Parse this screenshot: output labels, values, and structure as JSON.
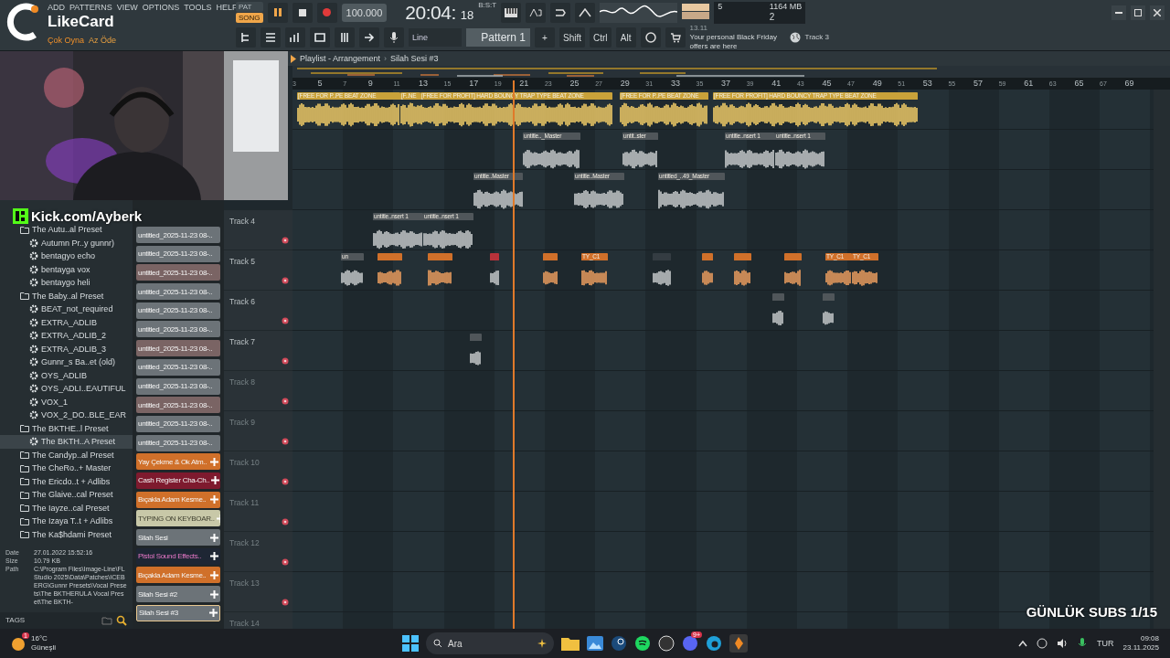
{
  "toolbar": {
    "menu": [
      "ADD",
      "PATTERNS",
      "VIEW",
      "OPTIONS",
      "TOOLS",
      "HELP"
    ],
    "brand": {
      "name": "LikeCard",
      "slogan_1": "Çok Oyna",
      "slogan_2": "Az Öde"
    },
    "mode": [
      {
        "label": "PAT",
        "selected": false
      },
      {
        "label": "SONG",
        "selected": true
      }
    ],
    "tempo": "100.000",
    "time": "20:04:",
    "time_small": "18",
    "time_unit": "B:S:T",
    "cpu": "5",
    "memory": "1164 MB",
    "polyphony": "2",
    "hint": "Track 3",
    "input": "Line",
    "pattern": "Pattern 1",
    "add": "+",
    "modifiers": [
      "Shift",
      "Ctrl",
      "Alt"
    ],
    "news": {
      "date": "13.11",
      "text": "Your personal Black Friday offers are here"
    }
  },
  "overlays": {
    "kick": "Kick.com/Ayberk",
    "subs": "GÜNLÜK SUBS 1/15"
  },
  "browser": {
    "items": [
      {
        "name": "The Autu..al Preset",
        "kind": "folder",
        "selected": false,
        "children": [
          {
            "name": "Autumn Pr..y gunnr)",
            "kind": "preset",
            "selected": false
          },
          {
            "name": "bentagyo echo",
            "kind": "preset",
            "selected": false
          },
          {
            "name": "bentayga vox",
            "kind": "preset",
            "selected": false
          },
          {
            "name": "bentaygo heli",
            "kind": "preset",
            "selected": false
          }
        ]
      },
      {
        "name": "The Baby..al Preset",
        "kind": "folder",
        "selected": false,
        "children": [
          {
            "name": "BEAT_not_required",
            "kind": "preset",
            "selected": false
          },
          {
            "name": "EXTRA_ADLIB",
            "kind": "preset",
            "selected": false
          },
          {
            "name": "EXTRA_ADLIB_2",
            "kind": "preset",
            "selected": false
          },
          {
            "name": "EXTRA_ADLIB_3",
            "kind": "preset",
            "selected": false
          },
          {
            "name": "Gunnr_s Ba..et (old)",
            "kind": "preset",
            "selected": false
          },
          {
            "name": "OYS_ADLIB",
            "kind": "preset",
            "selected": false
          },
          {
            "name": "OYS_ADLI..EAUTIFUL",
            "kind": "preset",
            "selected": false
          },
          {
            "name": "VOX_1",
            "kind": "preset",
            "selected": false
          },
          {
            "name": "VOX_2_DO..BLE_EAR",
            "kind": "preset",
            "selected": false
          }
        ]
      },
      {
        "name": "The BKTHE..l Preset",
        "kind": "folder",
        "selected": false,
        "children": [
          {
            "name": "The BKTH..A Preset",
            "kind": "preset",
            "selected": true
          }
        ]
      },
      {
        "name": "The Candyp..al Preset",
        "kind": "folder",
        "selected": false
      },
      {
        "name": "The CheRo..+ Master",
        "kind": "folder",
        "selected": false
      },
      {
        "name": "The Ericdo..t + Adlibs",
        "kind": "folder",
        "selected": false
      },
      {
        "name": "The Glaive..cal Preset",
        "kind": "folder",
        "selected": false
      },
      {
        "name": "The Iayze..cal Preset",
        "kind": "folder",
        "selected": false
      },
      {
        "name": "The Izaya T..t + Adlibs",
        "kind": "folder",
        "selected": false
      },
      {
        "name": "The Ka$hdami Preset",
        "kind": "folder",
        "selected": false
      }
    ],
    "info": [
      {
        "label": "Date",
        "value": "27.01.2022 15:52:16"
      },
      {
        "label": "Size",
        "value": "10.79 KB"
      },
      {
        "label": "Path",
        "value": "C:\\Program Files\\Image-Line\\FL Studio 2025\\Data\\Patches\\ICEBERG\\Gunnr Presets\\Vocal Presets\\The BKTHERULA Vocal Preset\\The BKTH-"
      }
    ],
    "tags": "TAGS"
  },
  "channels": [
    {
      "name": "untitled_2025-11-23 08-..",
      "color": "#6c7378",
      "kind": "pattern",
      "selected": false
    },
    {
      "name": "untitled_2025-11-23 08-..",
      "color": "#6c7378",
      "kind": "pattern",
      "selected": false
    },
    {
      "name": "untitled_2025-11-23 08-..",
      "color": "#7a6464",
      "kind": "pattern",
      "selected": false
    },
    {
      "name": "untitled_2025-11-23 08-..",
      "color": "#6c7378",
      "kind": "pattern",
      "selected": false
    },
    {
      "name": "untitled_2025-11-23 08-..",
      "color": "#6c7378",
      "kind": "pattern",
      "selected": false
    },
    {
      "name": "untitled_2025-11-23 08-..",
      "color": "#6c7378",
      "kind": "pattern",
      "selected": false
    },
    {
      "name": "untitled_2025-11-23 08-..",
      "color": "#7a6464",
      "kind": "pattern",
      "selected": false
    },
    {
      "name": "untitled_2025-11-23 08-..",
      "color": "#6c7378",
      "kind": "pattern",
      "selected": false
    },
    {
      "name": "untitled_2025-11-23 08-..",
      "color": "#6c7378",
      "kind": "pattern",
      "selected": false
    },
    {
      "name": "untitled_2025-11-23 08-..",
      "color": "#7a6464",
      "kind": "pattern",
      "selected": false
    },
    {
      "name": "untitled_2025-11-23 08-..",
      "color": "#6c7378",
      "kind": "pattern",
      "selected": false
    },
    {
      "name": "untitled_2025-11-23 08-..",
      "color": "#6c7378",
      "kind": "pattern",
      "selected": false
    },
    {
      "name": "Yay Çekme & Ok Atm..",
      "color": "#d0702a",
      "kind": "audio",
      "selected": false
    },
    {
      "name": "Cash Register Cha-Ch..",
      "color": "#7e1a2e",
      "kind": "audio",
      "selected": false
    },
    {
      "name": "Bıçakla Adam Kesme..",
      "color": "#d0702a",
      "kind": "audio",
      "selected": false
    },
    {
      "name": "TYPING ON KEYBOAR..",
      "color": "#c8c8a8",
      "kind": "audio",
      "selected": false
    },
    {
      "name": "Silah Sesi",
      "color": "#6c7378",
      "kind": "audio",
      "selected": false
    },
    {
      "name": "Pistol Sound Effects..",
      "color": "#1e2634",
      "kind": "audio",
      "selected": false
    },
    {
      "name": "Bıçakla Adam Kesme..",
      "color": "#d0702a",
      "kind": "audio",
      "selected": false
    },
    {
      "name": "Silah Sesi #2",
      "color": "#6c7378",
      "kind": "audio",
      "selected": false
    },
    {
      "name": "Silah Sesi #3",
      "color": "#6c7378",
      "kind": "audio",
      "selected": true
    }
  ],
  "playlist": {
    "title": "Playlist - Arrangement",
    "separator": "›",
    "pattern": "Silah Sesi #3",
    "ruler": [
      "3",
      "5",
      "7",
      "9",
      "11",
      "13",
      "15",
      "17",
      "19",
      "21",
      "23",
      "25",
      "27",
      "29",
      "31",
      "33",
      "35",
      "37",
      "39",
      "41",
      "43",
      "45",
      "47",
      "49",
      "51",
      "53",
      "55",
      "57",
      "59",
      "61",
      "63",
      "65",
      "67",
      "69"
    ],
    "tracks": [
      {
        "clips": [
          {
            "label": "[FREE FOR P..PE BEAT ZONE",
            "color": "#c9a23a"
          },
          {
            "label": "[F..NE",
            "color": "#c9a23a"
          },
          {
            "label": "[FREE FOR PROFIT] HARD BOUNCY TRAP TYPE BEAT ZONE",
            "color": "#c9a23a"
          },
          {
            "label": "[FREE FOR P..PE BEAT ZONE",
            "color": "#c9a23a"
          },
          {
            "label": "[FREE FOR PROFIT] HARD BOUNCY TRAP TYPE BEAT ZONE",
            "color": "#c9a23a"
          }
        ]
      },
      {
        "clips": [
          {
            "label": "untitle.._Master",
            "color": "#50565a"
          },
          {
            "label": "untit..ster",
            "color": "#50565a"
          },
          {
            "label": "untitle..nsert 1",
            "color": "#50565a"
          },
          {
            "label": "untitle..nsert 1",
            "color": "#50565a"
          }
        ]
      },
      {
        "clips": [
          {
            "label": "untitle..Master",
            "color": "#50565a"
          },
          {
            "label": "untitle..Master",
            "color": "#50565a"
          },
          {
            "label": "untitled_..49_Master",
            "color": "#50565a"
          }
        ]
      },
      {
        "name": "Track 4",
        "clips": [
          {
            "label": "untitle..nsert 1",
            "color": "#50565a"
          },
          {
            "label": "untitle..nsert 1",
            "color": "#50565a"
          }
        ]
      },
      {
        "name": "Track 5",
        "clips": [
          {
            "label": "un",
            "color": "#50565a"
          },
          {
            "color": "#d0702a"
          },
          {
            "color": "#d0702a"
          },
          {
            "color": "#b8323a"
          },
          {
            "color": "#d0702a"
          },
          {
            "label": "TY_C1",
            "color": "#d0702a"
          },
          {
            "color": "#343c42"
          },
          {
            "color": "#d0702a"
          },
          {
            "color": "#d0702a"
          },
          {
            "color": "#d0702a"
          },
          {
            "label": "TY_C1",
            "color": "#d0702a"
          },
          {
            "label": "TY_C1",
            "color": "#d0702a"
          }
        ]
      },
      {
        "name": "Track 6",
        "clips": [
          {
            "color": "#50565a"
          },
          {
            "color": "#50565a"
          }
        ]
      },
      {
        "name": "Track 7",
        "clips": [
          {
            "color": "#50565a"
          }
        ]
      },
      {
        "name": "Track 8"
      },
      {
        "name": "Track 9"
      },
      {
        "name": "Track 10"
      },
      {
        "name": "Track 11"
      },
      {
        "name": "Track 12"
      },
      {
        "name": "Track 13"
      },
      {
        "name": "Track 14"
      }
    ]
  },
  "taskbar": {
    "temperature": "16°C",
    "weather": "Güneşli",
    "weather_badge": "1",
    "search": "Ara",
    "discord_badge": "9+",
    "language": "TUR",
    "time": "09:08",
    "date": "23.11.2025"
  }
}
